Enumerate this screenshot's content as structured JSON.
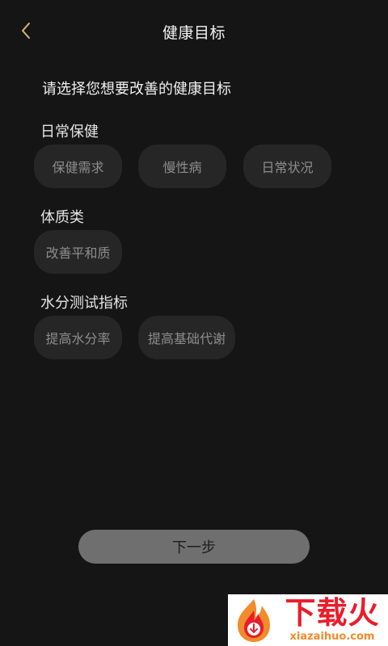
{
  "header": {
    "title": "健康目标",
    "back_icon": "chevron-left-icon"
  },
  "prompt": "请选择您想要改善的健康目标",
  "sections": [
    {
      "title": "日常保健",
      "options": [
        "保健需求",
        "慢性病",
        "日常状况"
      ]
    },
    {
      "title": "体质类",
      "options": [
        "改善平和质"
      ]
    },
    {
      "title": "水分测试指标",
      "options": [
        "提高水分率",
        "提高基础代谢"
      ]
    }
  ],
  "next_button": "下一步",
  "watermark": {
    "brand": "下载火",
    "domain": "xiazaihuo.com"
  },
  "colors": {
    "background": "#151515",
    "chip_background": "#262626",
    "chip_text": "#8d8d8d",
    "back_icon": "#d9b77a",
    "next_button": "#6f6f6f",
    "watermark_red": "#ea1d2a",
    "watermark_orange": "#f08c2b"
  }
}
